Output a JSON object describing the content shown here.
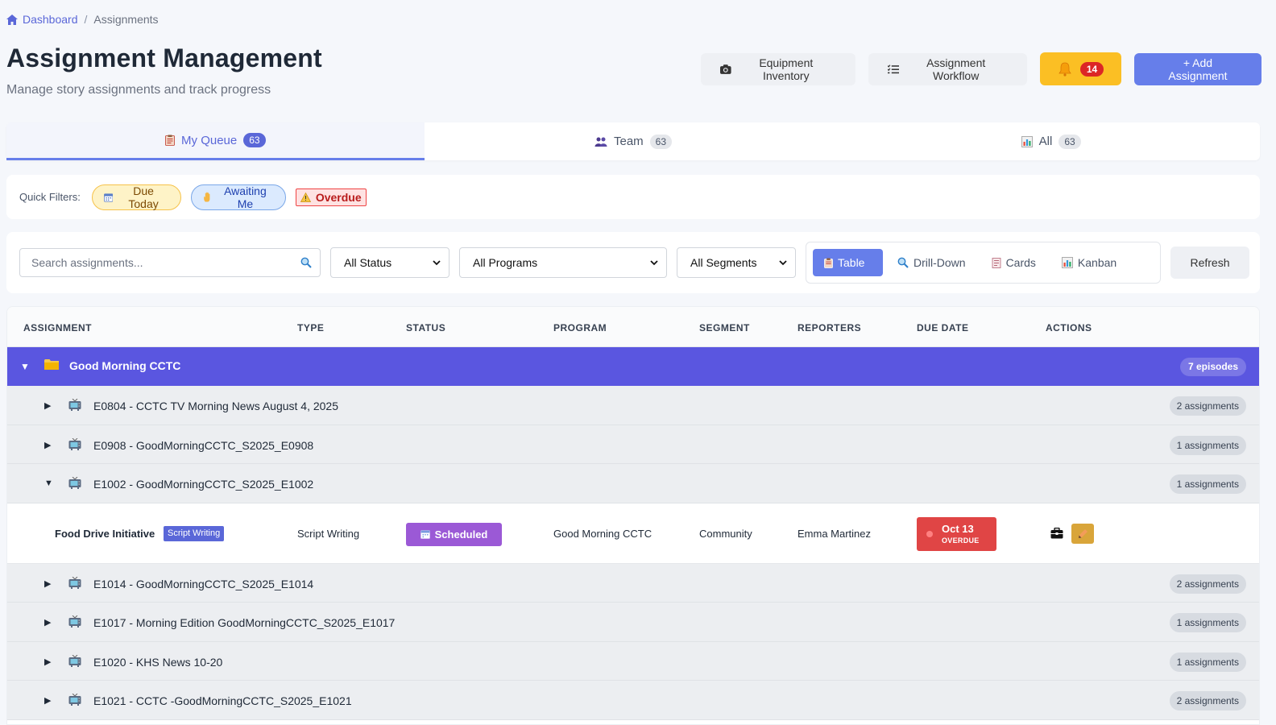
{
  "breadcrumb": {
    "home": "Dashboard",
    "separator": "/",
    "current": "Assignments"
  },
  "header": {
    "title": "Assignment Management",
    "subtitle": "Manage story assignments and track progress",
    "equipment_btn": "Equipment Inventory",
    "workflow_btn": "Assignment Workflow",
    "notification_count": "14",
    "add_btn": "+ Add Assignment"
  },
  "tabs": [
    {
      "label": "My Queue",
      "count": "63",
      "icon": "clipboard-icon"
    },
    {
      "label": "Team",
      "count": "63",
      "icon": "people-icon"
    },
    {
      "label": "All",
      "count": "63",
      "icon": "bar-chart-icon"
    }
  ],
  "quick_filters": {
    "label": "Quick Filters:",
    "due_today": "Due Today",
    "awaiting_me": "Awaiting Me",
    "overdue": "Overdue"
  },
  "toolbar": {
    "search_placeholder": "Search assignments...",
    "status_select": "All Status",
    "programs_select": "All Programs",
    "segments_select": "All Segments",
    "views": [
      "Table",
      "Drill-Down",
      "Cards",
      "Kanban"
    ],
    "refresh": "Refresh"
  },
  "table": {
    "columns": [
      "ASSIGNMENT",
      "TYPE",
      "STATUS",
      "PROGRAM",
      "SEGMENT",
      "REPORTERS",
      "DUE DATE",
      "ACTIONS"
    ],
    "group": {
      "title": "Good Morning CCTC",
      "badge": "7 episodes"
    },
    "episodes": [
      {
        "title": "E0804 - CCTC TV Morning News August 4, 2025",
        "badge": "2 assignments"
      },
      {
        "title": "E0908 - GoodMorningCCTC_S2025_E0908",
        "badge": "1 assignments"
      },
      {
        "title": "E1002 - GoodMorningCCTC_S2025_E1002",
        "badge": "1 assignments"
      },
      {
        "title": "E1014 - GoodMorningCCTC_S2025_E1014",
        "badge": "2 assignments"
      },
      {
        "title": "E1017 - Morning Edition GoodMorningCCTC_S2025_E1017",
        "badge": "1 assignments"
      },
      {
        "title": "E1020 - KHS News 10-20",
        "badge": "1 assignments"
      },
      {
        "title": "E1021 - CCTC -GoodMorningCCTC_S2025_E1021",
        "badge": "2 assignments"
      }
    ],
    "assignment": {
      "title": "Food Drive Initiative",
      "type_tag": "Script Writing",
      "type": "Script Writing",
      "status": "Scheduled",
      "program": "Good Morning CCTC",
      "segment": "Community",
      "reporters": "Emma Martinez",
      "due_date": "Oct 13",
      "due_note": "OVERDUE"
    }
  },
  "colors": {
    "accent": "#667eea",
    "group_row": "#5a56e0",
    "status_scheduled": "#9b59d6",
    "overdue": "#e04545",
    "bell": "#fbbf24"
  }
}
